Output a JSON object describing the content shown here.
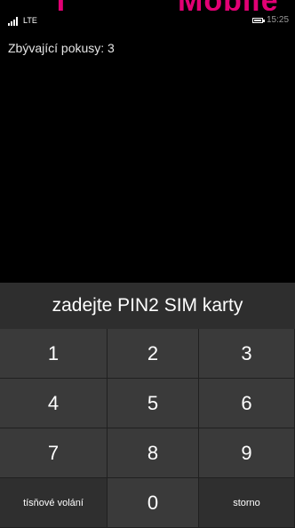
{
  "header": {
    "brand": "T · · Mobile"
  },
  "status_bar": {
    "network": "LTE",
    "time": "15:25",
    "signal_icon": "signal-bars-icon",
    "battery_icon": "battery-icon"
  },
  "main": {
    "attempts_text": "Zbývající pokusy: 3"
  },
  "pin_entry": {
    "prompt": "zadejte PIN2 SIM karty",
    "keys": {
      "k1": "1",
      "k2": "2",
      "k3": "3",
      "k4": "4",
      "k5": "5",
      "k6": "6",
      "k7": "7",
      "k8": "8",
      "k9": "9",
      "emergency": "tísňové volání",
      "k0": "0",
      "cancel": "storno"
    }
  }
}
